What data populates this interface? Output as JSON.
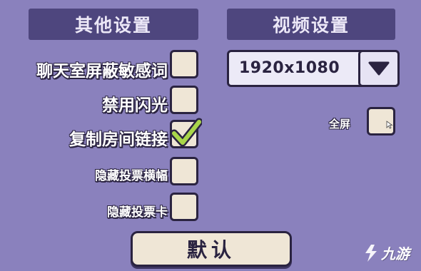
{
  "colors": {
    "background": "#8a81bd",
    "header_bg": "#4e467e",
    "checkbox_fill": "#efe6d6",
    "outline": "#2a2340",
    "checkmark": "#a9d64a"
  },
  "other_settings": {
    "header": "其他设置",
    "options": [
      {
        "label": "聊天室屏蔽敏感词",
        "checked": false
      },
      {
        "label": "禁用闪光",
        "checked": false
      },
      {
        "label": "复制房间链接",
        "checked": true
      },
      {
        "label": "隐藏投票横幅",
        "checked": false
      },
      {
        "label": "隐藏投票卡",
        "checked": false
      }
    ]
  },
  "video_settings": {
    "header": "视频设置",
    "resolution": "1920x1080",
    "dropdown_icon": "chevron-down-icon",
    "fullscreen_label": "全屏",
    "fullscreen_checked": false
  },
  "default_button": "默认",
  "watermark": {
    "text": "九游",
    "logo_icon": "jiuyou-logo-icon"
  }
}
